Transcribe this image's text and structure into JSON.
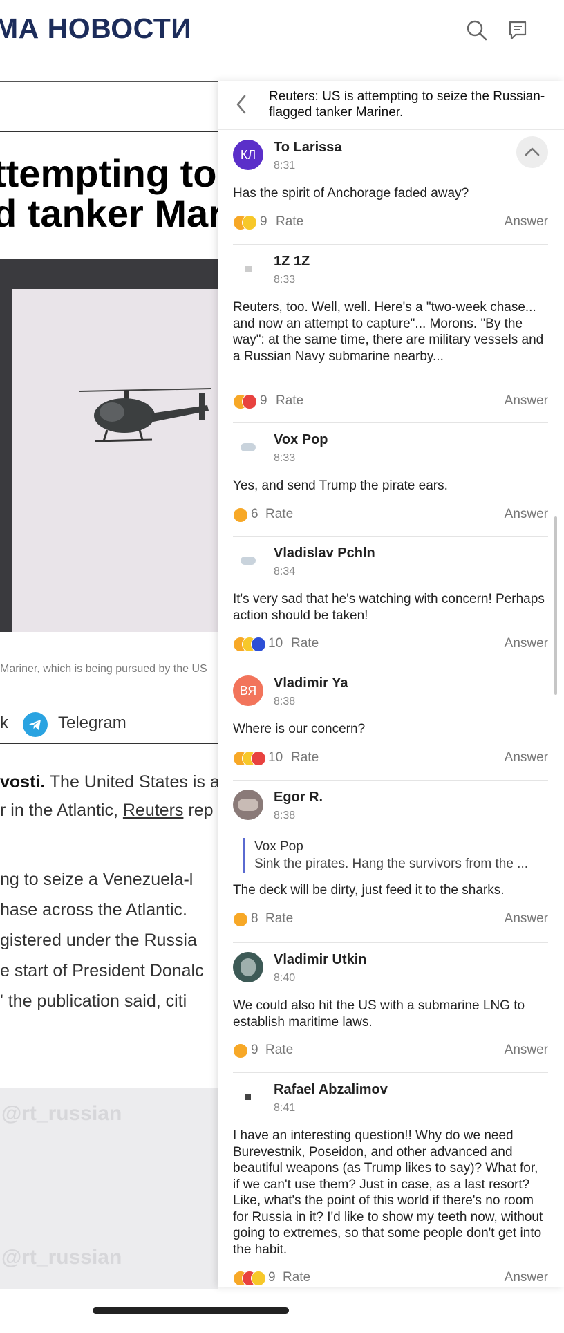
{
  "site": {
    "logo": "МА НОВОСТИ"
  },
  "article": {
    "title_lines": [
      "ttempting to s",
      "d tanker Marir"
    ],
    "caption": "Mariner, which is being pursued by the US",
    "share": {
      "left": "k",
      "telegram": "Telegram"
    },
    "paragraphs": [
      {
        "bold": "vosti.",
        "rest": " The United States is at"
      },
      {
        "pre": "r in the Atlantic, ",
        "link": "Reuters",
        "post": " rep"
      },
      {
        "text": "ng to seize a Venezuela-l"
      },
      {
        "text": "hase across the Atlantic."
      },
      {
        "text": "gistered under the Russia"
      },
      {
        "text": "e start of President Donalc"
      },
      {
        "text": "' the publication said, citi"
      }
    ],
    "watermark": "@rt_russian"
  },
  "panel": {
    "title": "Reuters: US is attempting to seize the Russian-flagged tanker Mariner.",
    "comments": [
      {
        "author": "To Larissa",
        "initials": "КЛ",
        "avatar_color": "#5b2fc9",
        "time": "8:31",
        "text": "Has the spirit of Anchorage faded away?",
        "count": "9",
        "rate": "Rate",
        "answer": "Answer"
      },
      {
        "author": "1Z 1Z",
        "initials": "",
        "avatar_color": "#ffffff",
        "time": "8:33",
        "text": "Reuters, too. Well, well. Here's a \"two-week chase... and now an attempt to capture\"... Morons. \"By the way\": at the same time, there are military vessels and a Russian Navy submarine nearby...",
        "count": "9",
        "rate": "Rate",
        "answer": "Answer"
      },
      {
        "author": "Vox Pop",
        "initials": "",
        "avatar_color": "#ffffff",
        "time": "8:33",
        "text": "Yes, and send Trump the pirate ears.",
        "count": "6",
        "rate": "Rate",
        "answer": "Answer"
      },
      {
        "author": "Vladislav Pchln",
        "initials": "",
        "avatar_color": "#ffffff",
        "time": "8:34",
        "text": "It's very sad that he's watching with concern! Perhaps action should be taken!",
        "count": "10",
        "rate": "Rate",
        "answer": "Answer"
      },
      {
        "author": "Vladimir Ya",
        "initials": "ВЯ",
        "avatar_color": "#f2745b",
        "time": "8:38",
        "text": "Where is our concern?",
        "count": "10",
        "rate": "Rate",
        "answer": "Answer"
      },
      {
        "author": "Egor R.",
        "initials": "",
        "avatar_color": "#8a7a78",
        "time": "8:38",
        "quote_author": "Vox Pop",
        "quote_text": "Sink the pirates. Hang the survivors from the ...",
        "text": "The deck will be dirty, just feed it to the sharks.",
        "count": "8",
        "rate": "Rate",
        "answer": "Answer"
      },
      {
        "author": "Vladimir Utkin",
        "initials": "",
        "avatar_color": "#3d5a56",
        "time": "8:40",
        "text": "We could also hit the US with a submarine LNG to establish maritime laws.",
        "count": "9",
        "rate": "Rate",
        "answer": "Answer"
      },
      {
        "author": "Rafael Abzalimov",
        "initials": "",
        "avatar_color": "#ffffff",
        "time": "8:41",
        "text": "I have an interesting question!! Why do we need Burevestnik, Poseidon, and other advanced and beautiful weapons (as Trump likes to say)? What for, if we can't use them? Just in case, as a last resort? Like, what's the point of this world if there's no room for Russia in it? I'd like to show my teeth now, without going to extremes, so that some people don't get into the habit.",
        "count": "9",
        "rate": "Rate",
        "answer": "Answer"
      }
    ]
  },
  "colors": {
    "brand": "#1c2c5a",
    "quote_bar": "#5a6ad0",
    "telegram": "#2aa3e1"
  }
}
